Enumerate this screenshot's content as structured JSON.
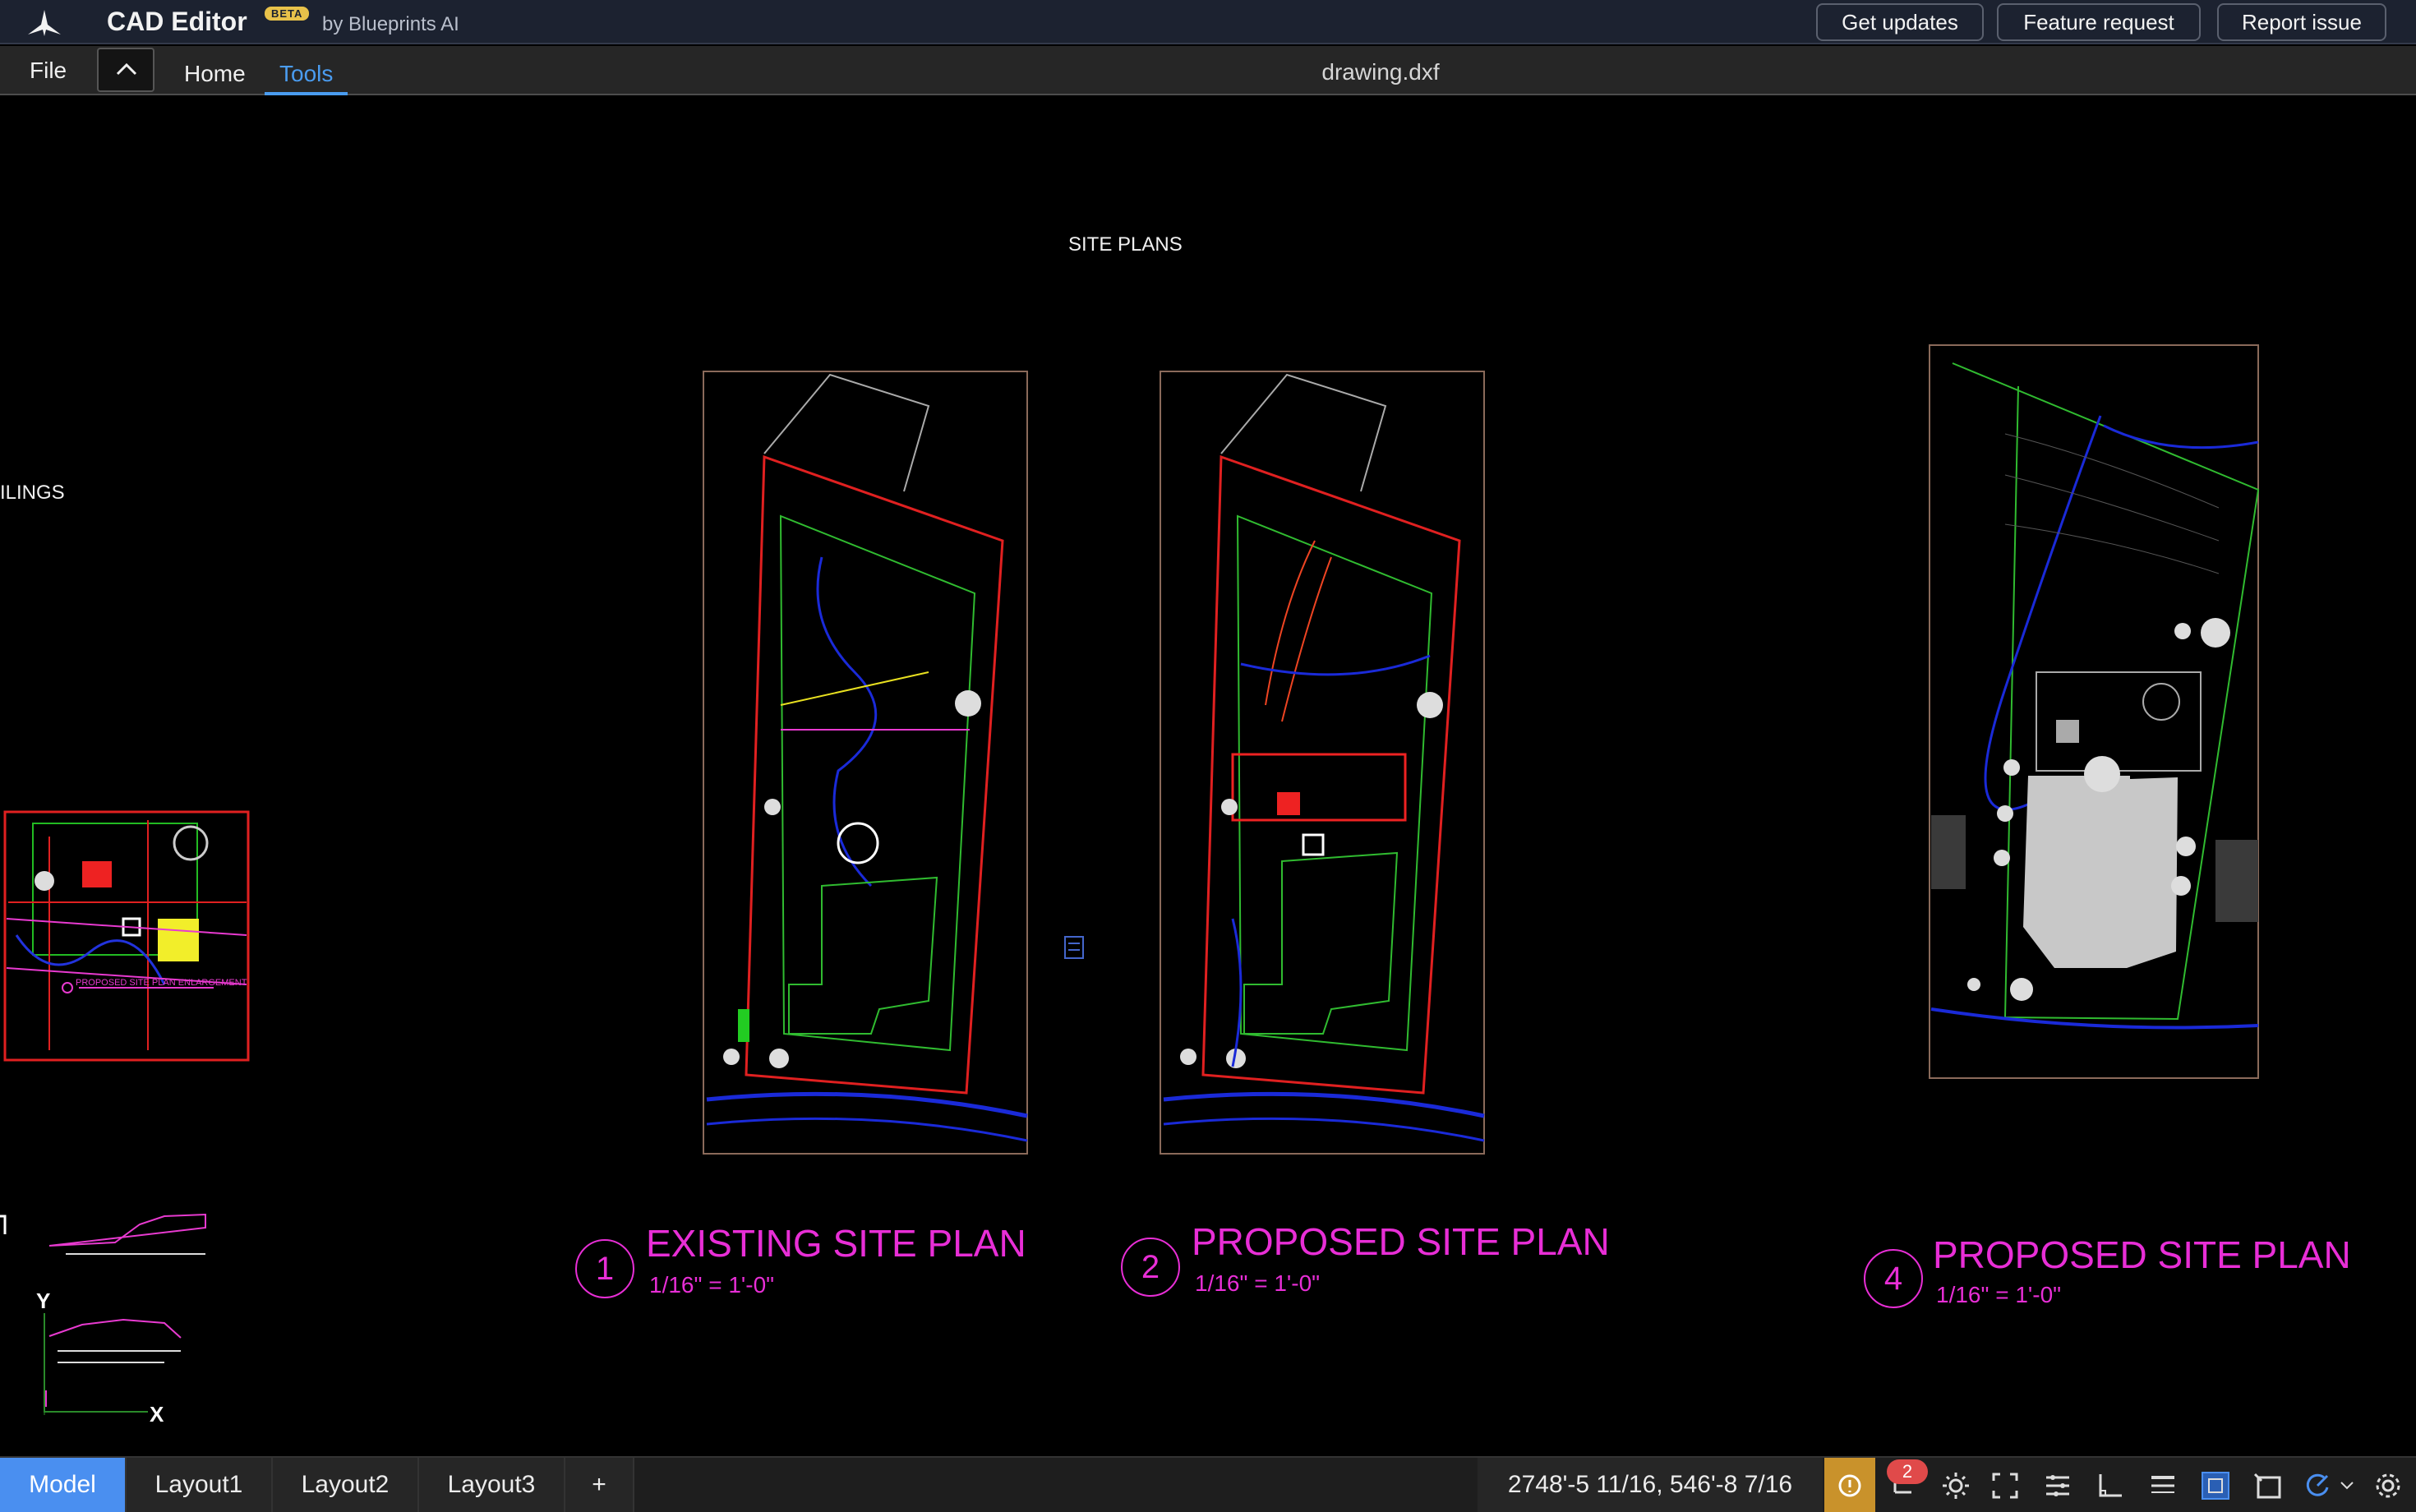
{
  "header": {
    "app_title": "CAD Editor",
    "beta_badge": "BETA",
    "byline": "by Blueprints AI",
    "buttons": {
      "get_updates": "Get updates",
      "feature_request": "Feature request",
      "report_issue": "Report issue"
    }
  },
  "menu": {
    "file": "File",
    "tabs": [
      {
        "label": "Home",
        "active": false
      },
      {
        "label": "Tools",
        "active": true
      }
    ],
    "document_title": "drawing.dxf"
  },
  "canvas": {
    "sheet_title": "SITE PLANS",
    "left_edge_text": "ILINGS",
    "left_caption": "PROPOSED SITE PLAN ENLARGEMENT",
    "axis": {
      "x": "X",
      "y": "Y"
    },
    "plans": [
      {
        "number": "1",
        "title": "EXISTING SITE PLAN",
        "scale": "1/16\" = 1'-0\""
      },
      {
        "number": "2",
        "title": "PROPOSED SITE PLAN",
        "scale": "1/16\" = 1'-0\""
      },
      {
        "number": "4",
        "title": "PROPOSED SITE PLAN",
        "scale": "1/16\" = 1'-0\""
      }
    ]
  },
  "statusbar": {
    "layout_tabs": [
      {
        "label": "Model",
        "active": true
      },
      {
        "label": "Layout1",
        "active": false
      },
      {
        "label": "Layout2",
        "active": false
      },
      {
        "label": "Layout3",
        "active": false
      },
      {
        "label": "+",
        "active": false
      }
    ],
    "coordinates": "2748'-5 11/16, 546'-8 7/16",
    "notification_count": "2",
    "colors": {
      "active_tab": "#4a8ff0",
      "warning": "#c9922b",
      "badge": "#e04a4a",
      "annotation": "#e82ed6"
    }
  }
}
